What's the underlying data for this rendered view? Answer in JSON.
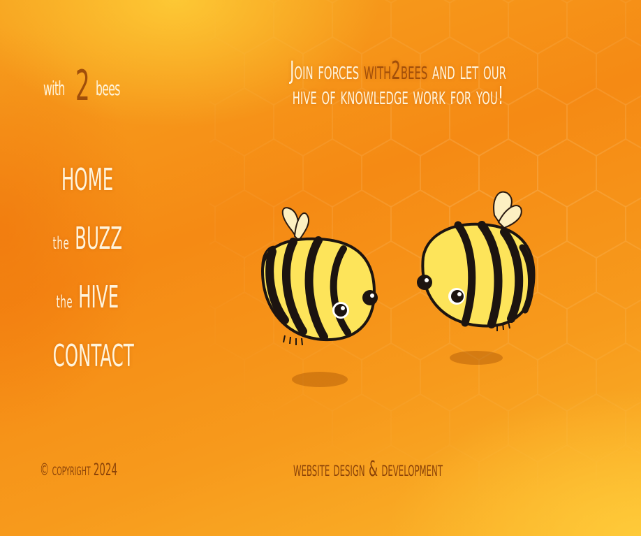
{
  "brand": {
    "logo_prefix": "with",
    "logo_number": "2",
    "logo_suffix": "bees"
  },
  "headline": {
    "line1_start": "Join forces ",
    "line1_accent": "with2bees",
    "line1_end": " and let our",
    "line2": "hive of knowledge work for you!"
  },
  "nav": {
    "home": "HOME",
    "buzz_prefix": "the",
    "buzz": "BUZZ",
    "hive_prefix": "the",
    "hive": "HIVE",
    "contact": "CONTACT"
  },
  "footer": {
    "copyright": "© copyright 2024",
    "tagline": "website design & development"
  },
  "colors": {
    "accent_brown": "#a04e0a",
    "text_cream": "#fff4dc",
    "bee_yellow": "#fde45a",
    "background_orange": "#f58a14"
  },
  "icons": [
    "bee-illustration-left",
    "bee-illustration-right"
  ]
}
